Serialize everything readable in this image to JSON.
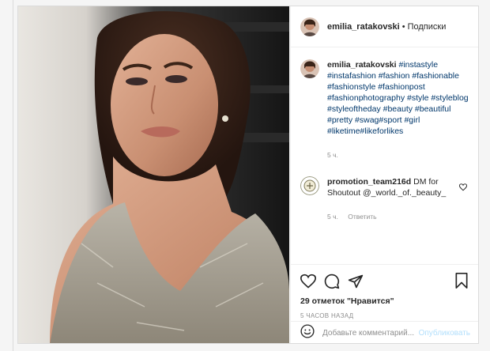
{
  "post": {
    "username": "emilia_ratakovski",
    "dot": "•",
    "follow_label": "Подписки"
  },
  "caption": {
    "username": "emilia_ratakovski",
    "hashtags": "#instastyle #instafashion #fashion #fashionable #fashionstyle #fashionpost #fashionphotography #style #styleblog #styleoftheday #beauty #beautiful #pretty #swag#sport #girl #liketime#likeforlikes",
    "time": "5 ч."
  },
  "comment": {
    "username": "promotion_team216d",
    "text": "DM for Shoutout @_world._of._beauty_",
    "time": "5 ч.",
    "reply_label": "Ответить"
  },
  "stats": {
    "likes": "29 отметок \"Нравится\"",
    "time_ago": "5 ЧАСОВ НАЗАД"
  },
  "composer": {
    "placeholder": "Добавьте комментарий...",
    "publish_label": "Опубликовать"
  },
  "colors": {
    "link": "#00376b",
    "muted": "#8e8e8e",
    "publish_disabled": "#b2dffc",
    "border": "#dbdbdb"
  },
  "icons": {
    "like": "heart-icon",
    "comment": "comment-icon",
    "share": "share-icon",
    "save": "bookmark-icon",
    "emoji": "smiley-icon",
    "comment_like": "heart-icon"
  }
}
